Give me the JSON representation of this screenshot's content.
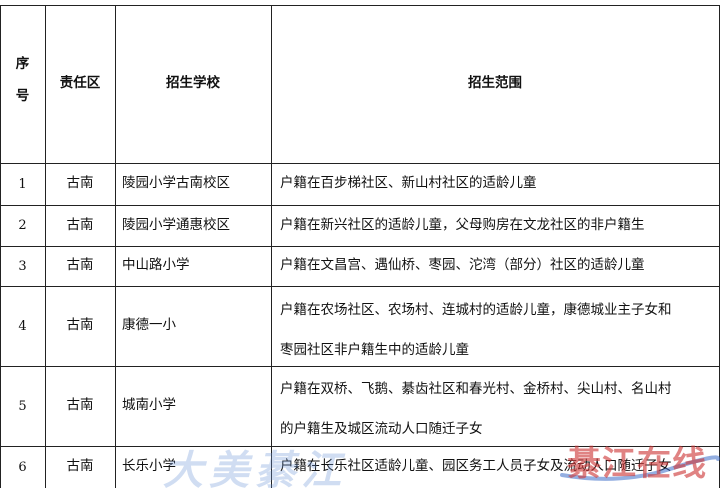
{
  "table": {
    "headers": {
      "seq_line1": "序",
      "seq_line2": "号",
      "district": "责任区",
      "school": "招生学校",
      "range": "招生范围"
    },
    "rows": [
      {
        "seq": "1",
        "district": "古南",
        "school": "陵园小学古南校区",
        "range": [
          "户籍在百步梯社区、新山村社区的适龄儿童"
        ]
      },
      {
        "seq": "2",
        "district": "古南",
        "school": "陵园小学通惠校区",
        "range": [
          "户籍在新兴社区的适龄儿童，父母购房在文龙社区的非户籍生"
        ]
      },
      {
        "seq": "3",
        "district": "古南",
        "school": "中山路小学",
        "range": [
          "户籍在文昌宫、遇仙桥、枣园、沱湾（部分）社区的适龄儿童"
        ]
      },
      {
        "seq": "4",
        "district": "古南",
        "school": "康德一小",
        "range": [
          "户籍在农场社区、农场村、连城村的适龄儿童，康德城业主子女和",
          "枣园社区非户籍生中的适龄儿童"
        ]
      },
      {
        "seq": "5",
        "district": "古南",
        "school": "城南小学",
        "range": [
          "户籍在双桥、飞鹅、綦齿社区和春光村、金桥村、尖山村、名山村",
          "的户籍生及城区流动人口随迁子女"
        ]
      },
      {
        "seq": "6",
        "district": "古南",
        "school": "长乐小学",
        "range": [
          "户籍在长乐社区适龄儿童、园区务工人员子女及流动人口随迁子女"
        ]
      }
    ]
  },
  "watermark": {
    "left_text": "大美綦江",
    "right_text": "綦江在线"
  }
}
